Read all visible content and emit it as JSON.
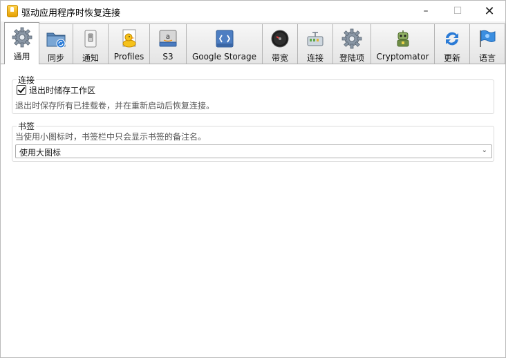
{
  "window": {
    "title": "驱动应用程序时恢复连接",
    "minimize_glyph": "–",
    "maximize_glyph": "☐",
    "close_glyph": "✕"
  },
  "toolbar": {
    "tabs": [
      {
        "label": "通用",
        "icon": "gear-icon",
        "selected": true
      },
      {
        "label": "同步",
        "icon": "sync-folder-icon",
        "selected": false
      },
      {
        "label": "通知",
        "icon": "notification-switch-icon",
        "selected": false
      },
      {
        "label": "Profiles",
        "icon": "profiles-duck-icon",
        "selected": false
      },
      {
        "label": "S3",
        "icon": "s3-icon",
        "selected": false
      },
      {
        "label": "Google Storage",
        "icon": "google-storage-icon",
        "selected": false
      },
      {
        "label": "带宽",
        "icon": "bandwidth-gauge-icon",
        "selected": false
      },
      {
        "label": "连接",
        "icon": "connection-icon",
        "selected": false
      },
      {
        "label": "登陆项",
        "icon": "login-items-gear-icon",
        "selected": false
      },
      {
        "label": "Cryptomator",
        "icon": "cryptomator-robot-icon",
        "selected": false
      },
      {
        "label": "更新",
        "icon": "update-icon",
        "selected": false
      },
      {
        "label": "语言",
        "icon": "language-flag-icon",
        "selected": false
      }
    ]
  },
  "connection_group": {
    "title": "连接",
    "checkbox_label": "退出时储存工作区",
    "checked": true,
    "description": "退出时保存所有已挂载卷，并在重新启动后恢复连接。"
  },
  "bookmark_group": {
    "title": "书签",
    "description": "当使用小图标时，书签栏中只会显示书签的备注名。",
    "select_value": "使用大图标"
  },
  "colors": {
    "accent_blue": "#2b7bd6",
    "duck_yellow": "#f5c21b",
    "window_border": "#b9b9b9"
  }
}
